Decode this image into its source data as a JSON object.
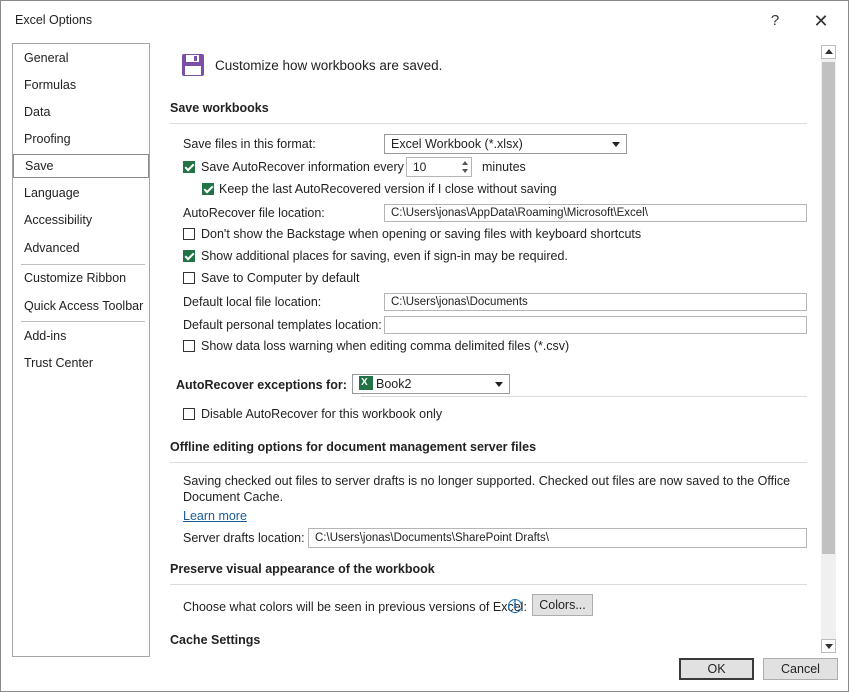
{
  "window": {
    "title": "Excel Options",
    "help_glyph": "?",
    "close_glyph": "✕"
  },
  "sidebar": {
    "items": [
      {
        "label": "General"
      },
      {
        "label": "Formulas"
      },
      {
        "label": "Data"
      },
      {
        "label": "Proofing"
      },
      {
        "label": "Save",
        "selected": true
      },
      {
        "label": "Language"
      },
      {
        "label": "Accessibility"
      },
      {
        "label": "Advanced"
      },
      {
        "label": "Customize Ribbon"
      },
      {
        "label": "Quick Access Toolbar"
      },
      {
        "label": "Add-ins"
      },
      {
        "label": "Trust Center"
      }
    ]
  },
  "header": {
    "text": "Customize how workbooks are saved.",
    "icon": "floppy-disk-icon"
  },
  "save_workbooks": {
    "title": "Save workbooks",
    "format_label": "Save files in this format:",
    "format_value": "Excel Workbook (*.xlsx)",
    "autorecover_label": "Save AutoRecover information every",
    "autorecover_checked": true,
    "autorecover_minutes": "10",
    "minutes_label": "minutes",
    "keep_last_label": "Keep the last AutoRecovered version if I close without saving",
    "keep_last_checked": true,
    "autorecover_location_label": "AutoRecover file location:",
    "autorecover_location_value": "C:\\Users\\jonas\\AppData\\Roaming\\Microsoft\\Excel\\",
    "backstage_label": "Don't show the Backstage when opening or saving files with keyboard shortcuts",
    "backstage_checked": false,
    "additional_places_label": "Show additional places for saving, even if sign-in may be required.",
    "additional_places_checked": true,
    "save_computer_label": "Save to Computer by default",
    "save_computer_checked": false,
    "default_local_label": "Default local file location:",
    "default_local_value": "C:\\Users\\jonas\\Documents",
    "personal_templates_label": "Default personal templates location:",
    "personal_templates_value": "",
    "data_loss_label": "Show data loss warning when editing comma delimited files (*.csv)",
    "data_loss_checked": false
  },
  "autorecover_exceptions": {
    "label": "AutoRecover exceptions for:",
    "workbook": "Book2",
    "disable_label": "Disable AutoRecover for this workbook only",
    "disable_checked": false
  },
  "offline": {
    "title": "Offline editing options for document management server files",
    "message_line1": "Saving checked out files to server drafts is no longer supported. Checked out files are now saved to the Office",
    "message_line2": "Document Cache.",
    "learn_more": "Learn more",
    "drafts_label": "Server drafts location:",
    "drafts_value": "C:\\Users\\jonas\\Documents\\SharePoint Drafts\\"
  },
  "preserve": {
    "title": "Preserve visual appearance of the workbook",
    "colors_label": "Choose what colors will be seen in previous versions of Excel:",
    "info_glyph": "i",
    "colors_button": "Colors..."
  },
  "cache": {
    "title": "Cache Settings"
  },
  "footer": {
    "ok": "OK",
    "cancel": "Cancel"
  },
  "colors": {
    "excel_green": "#217346",
    "link_blue": "#1a5c9a",
    "floppy_purple": "#7b4fa8"
  }
}
